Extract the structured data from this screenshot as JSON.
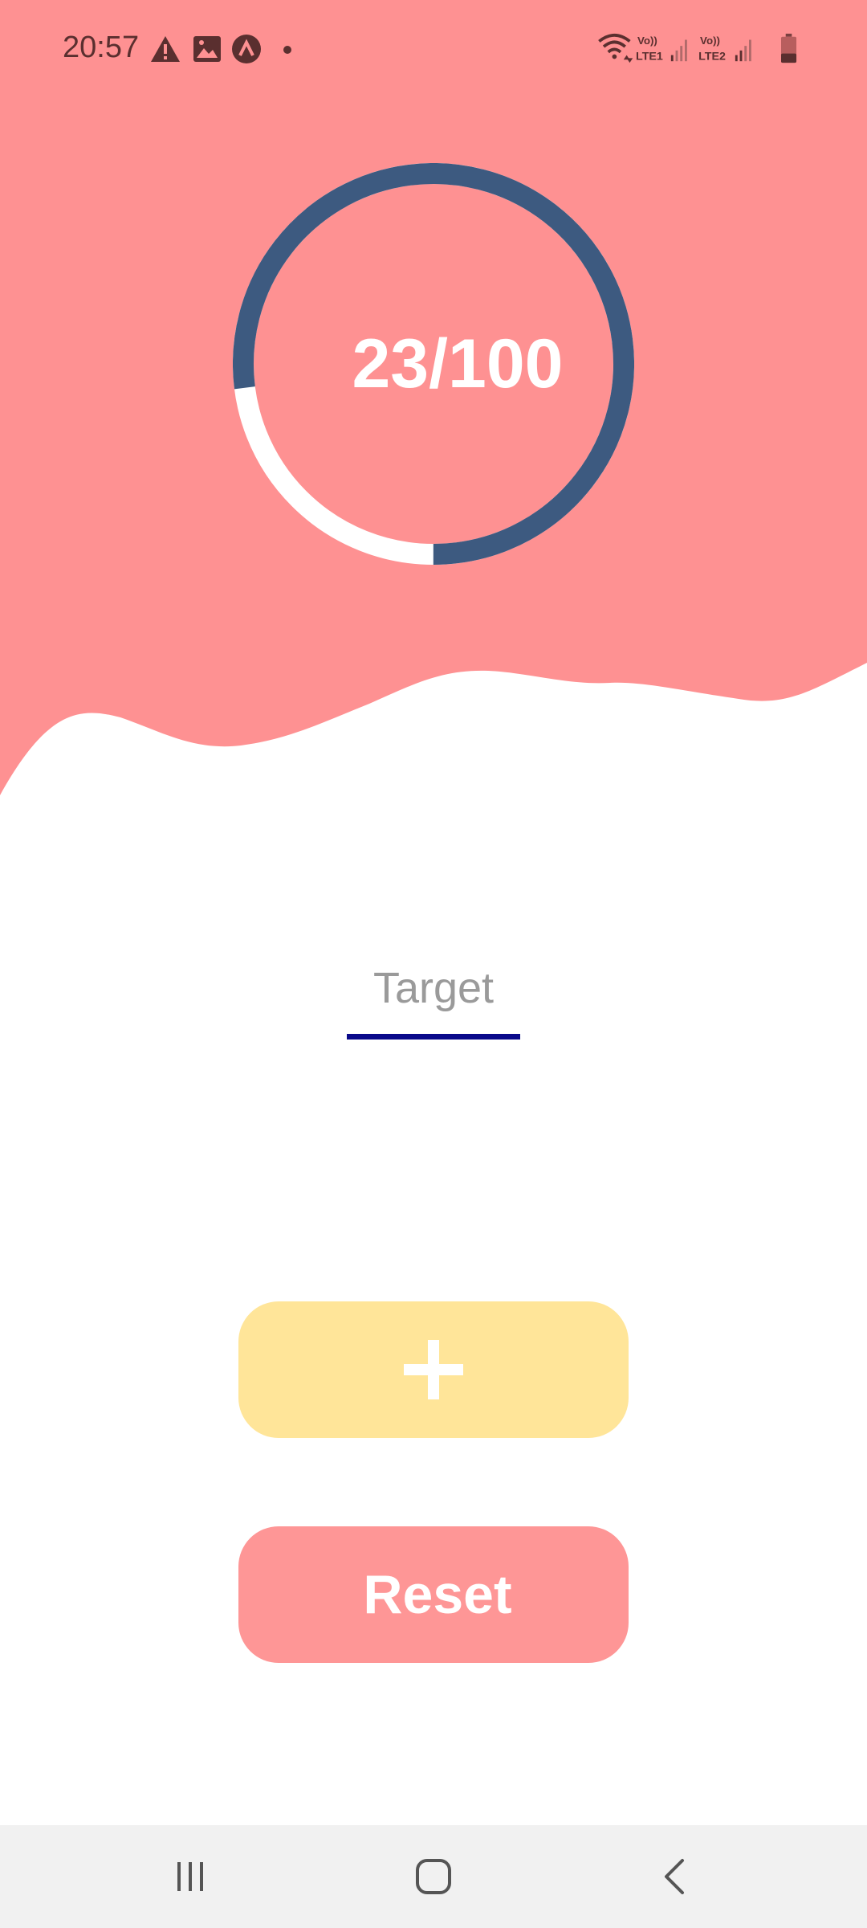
{
  "status_bar": {
    "time": "20:57",
    "left_icons": [
      "warning-icon",
      "gallery-icon",
      "app-a-icon",
      "dot-icon"
    ],
    "right_icons": [
      "wifi-icon",
      "signal-lte1-icon",
      "signal-lte2-icon",
      "battery-icon"
    ],
    "sim1_label": "LTE1",
    "sim2_label": "LTE2",
    "volte_label": "Vo))"
  },
  "counter": {
    "display": "23/100",
    "current": 23,
    "target": 100,
    "progress_fraction": 0.23
  },
  "target_input": {
    "placeholder": "Target",
    "value": ""
  },
  "buttons": {
    "add_icon": "plus-icon",
    "reset_label": "Reset"
  },
  "nav": {
    "recents_icon": "recents-icon",
    "home_icon": "home-icon",
    "back_icon": "back-icon"
  },
  "colors": {
    "header": "#fe9192",
    "ring_track": "#ffffff",
    "ring_fill": "#3d5a80",
    "input_underline": "#0a0a8a",
    "add_button": "#ffe599",
    "reset_button": "#fe9696",
    "nav_bar": "#f1f1f1"
  }
}
